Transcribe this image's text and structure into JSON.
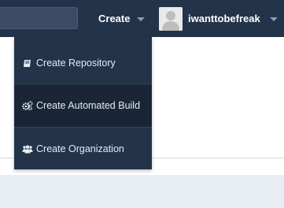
{
  "topbar": {
    "create_label": "Create",
    "username": "iwanttobefreak"
  },
  "dropdown": {
    "items": [
      {
        "label": "Create Repository",
        "icon": "book-icon"
      },
      {
        "label": "Create Automated Build",
        "icon": "gears-icon"
      },
      {
        "label": "Create Organization",
        "icon": "users-icon"
      }
    ]
  },
  "colors": {
    "navbar": "#22334a",
    "menu_hover": "#1a2637",
    "content_band": "#e9eef5"
  }
}
